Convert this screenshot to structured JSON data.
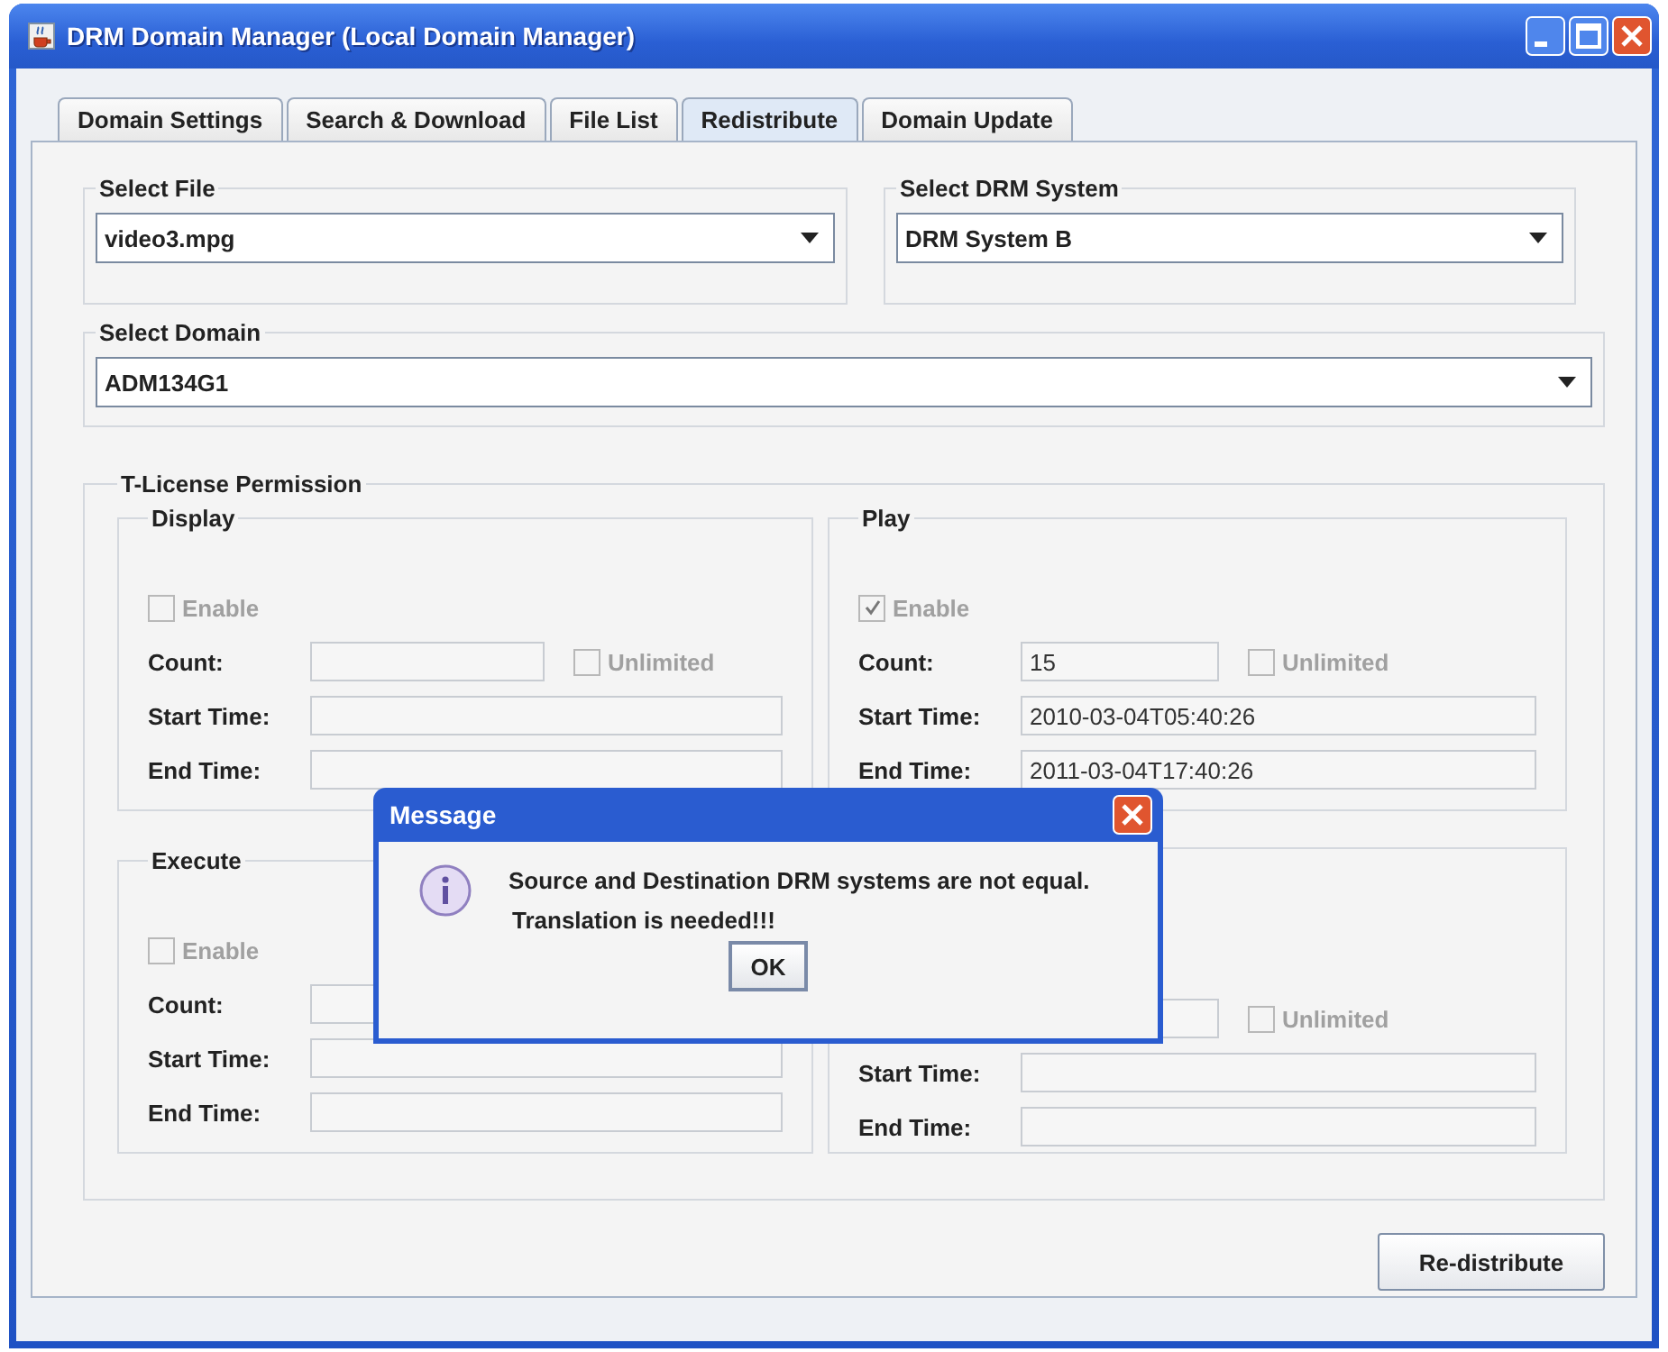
{
  "window": {
    "title": "DRM Domain Manager (Local Domain Manager)"
  },
  "tabs": [
    {
      "label": "Domain Settings",
      "selected": false
    },
    {
      "label": "Search & Download",
      "selected": false
    },
    {
      "label": "File List",
      "selected": false
    },
    {
      "label": "Redistribute",
      "selected": true
    },
    {
      "label": "Domain Update",
      "selected": false
    }
  ],
  "select_file": {
    "label": "Select File",
    "value": "video3.mpg"
  },
  "select_drm_system": {
    "label": "Select DRM System",
    "value": "DRM System B"
  },
  "select_domain": {
    "label": "Select Domain",
    "value": "ADM134G1"
  },
  "license": {
    "title": "T-License Permission",
    "permissions": [
      {
        "title": "Display",
        "enable": {
          "label": "Enable",
          "checked": false,
          "disabled": true
        },
        "count_label": "Count:",
        "unlimited": {
          "label": "Unlimited",
          "checked": false,
          "disabled": true
        },
        "start_label": "Start Time:",
        "end_label": "End Time:"
      },
      {
        "title": "Play",
        "enable": {
          "label": "Enable",
          "checked": true,
          "disabled": true
        },
        "count_label": "Count:",
        "count": "15",
        "unlimited": {
          "label": "Unlimited",
          "checked": false,
          "disabled": true
        },
        "start_label": "Start Time:",
        "start": "2010-03-04T05:40:26",
        "end_label": "End Time:",
        "end": "2011-03-04T17:40:26"
      },
      {
        "title": "Execute",
        "enable": {
          "label": "Enable",
          "checked": false,
          "disabled": true
        },
        "count_label": "Count:",
        "start_label": "Start Time:",
        "end_label": "End Time:"
      },
      {
        "unlimited": {
          "label": "Unlimited",
          "checked": false,
          "disabled": true
        },
        "start_label": "Start Time:",
        "end_label": "End Time:"
      }
    ]
  },
  "action_button": "Re-distribute",
  "dialog": {
    "title": "Message",
    "lines": [
      "Source and Destination DRM systems are not equal.",
      "Translation is needed!!!"
    ],
    "button": "OK"
  }
}
